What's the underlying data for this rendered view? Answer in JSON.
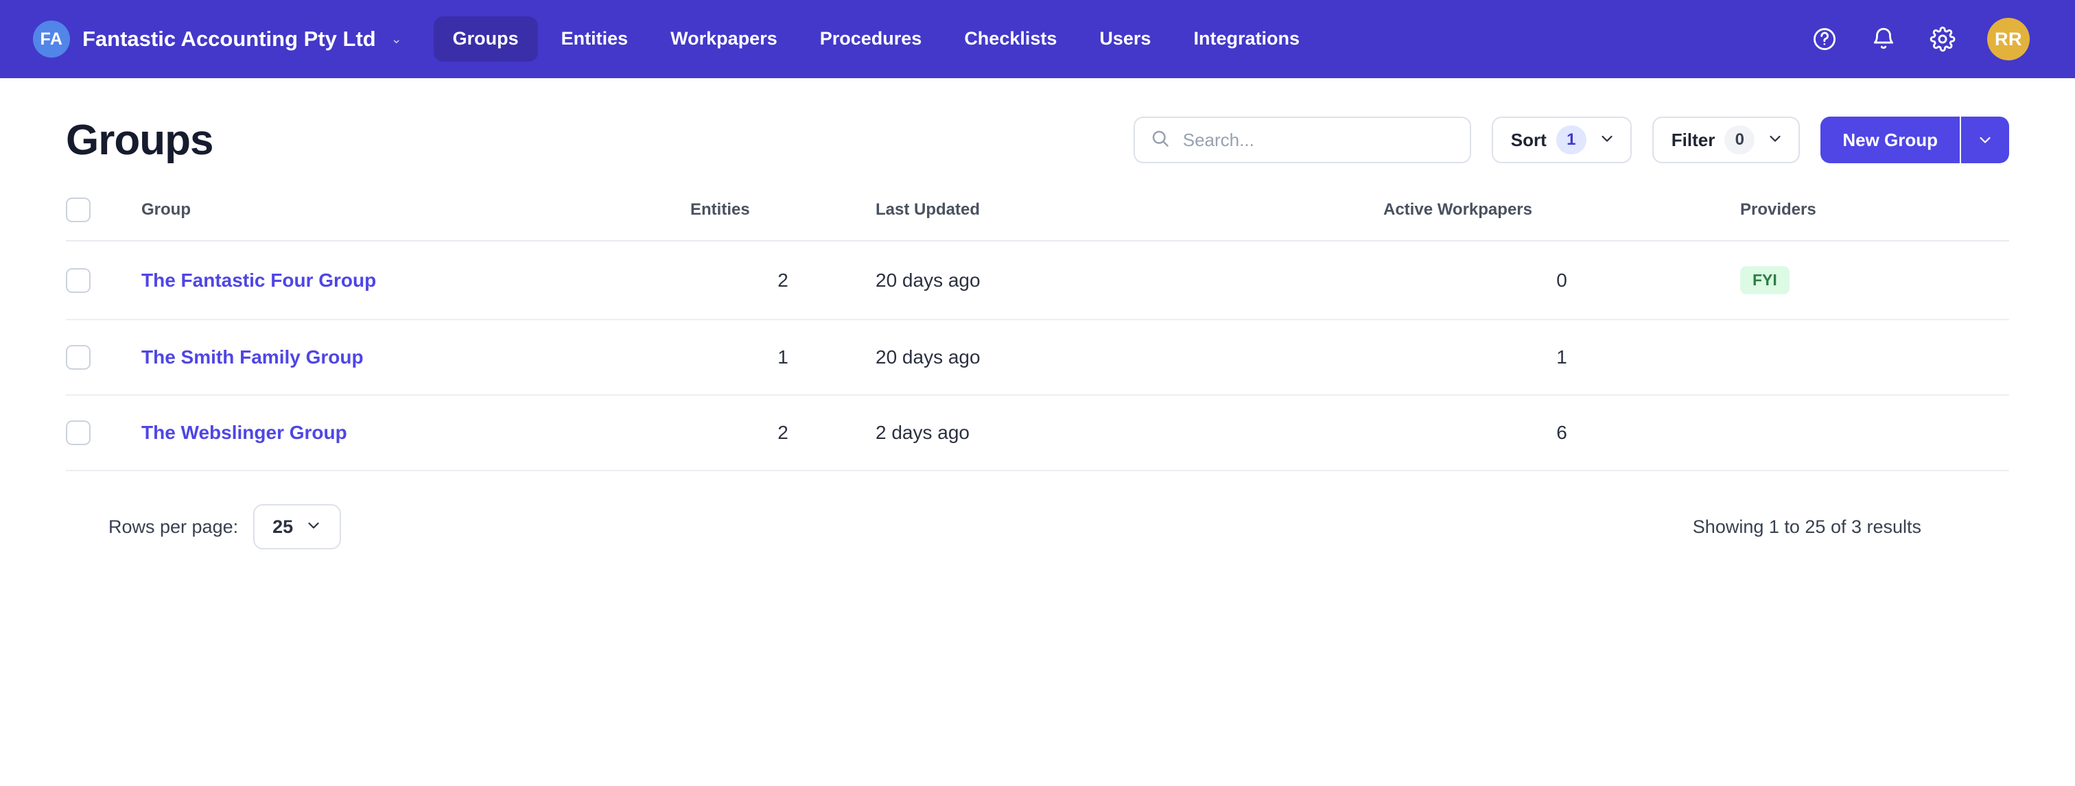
{
  "topbar": {
    "org_initials": "FA",
    "org_name": "Fantastic Accounting Pty Ltd",
    "org_caret": "⌄",
    "nav_items": [
      {
        "label": "Groups",
        "active": true
      },
      {
        "label": "Entities",
        "active": false
      },
      {
        "label": "Workpapers",
        "active": false
      },
      {
        "label": "Procedures",
        "active": false
      },
      {
        "label": "Checklists",
        "active": false
      },
      {
        "label": "Users",
        "active": false
      },
      {
        "label": "Integrations",
        "active": false
      }
    ],
    "icons": [
      "help-circle-icon",
      "bell-icon",
      "gear-icon"
    ],
    "user_initials": "RR",
    "user_avatar_color": "#E3B23C"
  },
  "page": {
    "title": "Groups"
  },
  "toolbar": {
    "search_placeholder": "Search...",
    "search_value": "",
    "sort_label": "Sort",
    "sort_count": "1",
    "filter_label": "Filter",
    "filter_count": "0",
    "new_group_label": "New Group",
    "primary_color": "#4F46E5",
    "sort_badge_bg": "#E0E7FF",
    "sort_badge_fg": "#4338CA"
  },
  "table": {
    "columns": [
      {
        "key": "group",
        "label": "Group"
      },
      {
        "key": "entities",
        "label": "Entities"
      },
      {
        "key": "last_updated",
        "label": "Last Updated"
      },
      {
        "key": "active_workpapers",
        "label": "Active Workpapers"
      },
      {
        "key": "providers",
        "label": "Providers"
      }
    ],
    "rows": [
      {
        "group": "The Fantastic Four Group",
        "entities": "2",
        "last_updated": "20 days ago",
        "active_workpapers": "0",
        "providers": "FYI"
      },
      {
        "group": "The Smith Family Group",
        "entities": "1",
        "last_updated": "20 days ago",
        "active_workpapers": "1",
        "providers": ""
      },
      {
        "group": "The Webslinger Group",
        "entities": "2",
        "last_updated": "2 days ago",
        "active_workpapers": "6",
        "providers": ""
      }
    ],
    "link_color": "#4F46E5",
    "tag_bg": "#DCFAE4",
    "tag_fg": "#2E7D45"
  },
  "footer": {
    "rows_per_page_label": "Rows per page:",
    "rows_per_page_value": "25",
    "results_text": "Showing 1 to 25 of 3 results"
  }
}
